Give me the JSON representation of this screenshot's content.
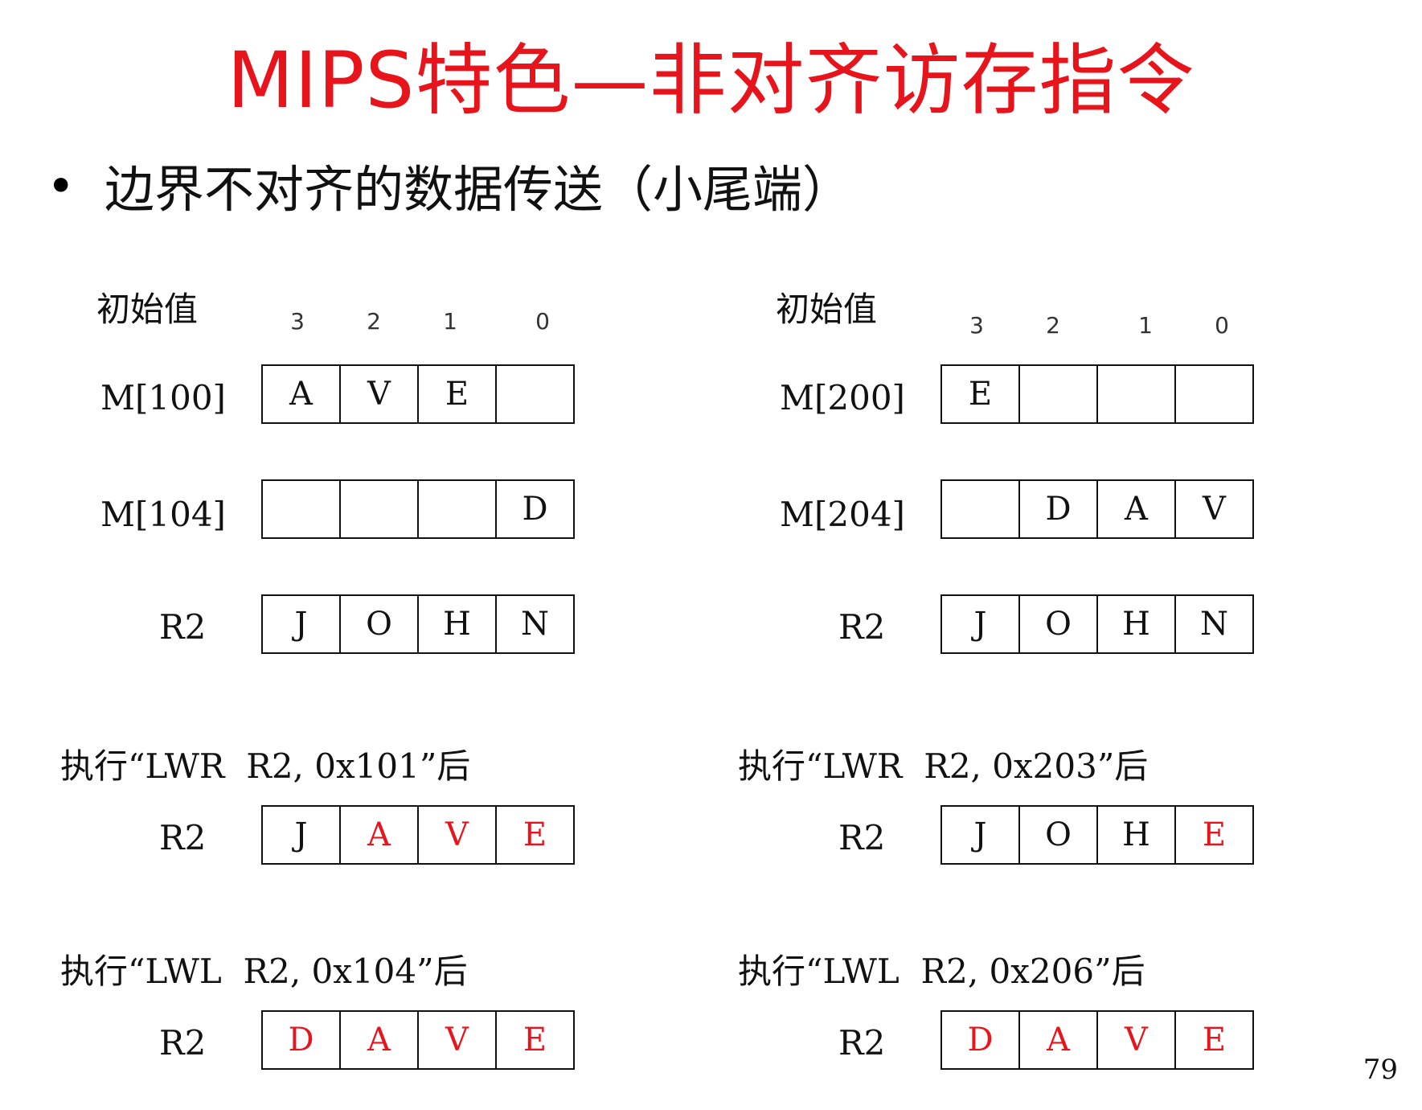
{
  "title": "MIPS特色—非对齐访存指令",
  "bullet": "边界不对齐的数据传送（小尾端）",
  "byte_indices": [
    "3",
    "2",
    "1",
    "0"
  ],
  "left": {
    "initial_label": "初始值",
    "rows": [
      {
        "label": "M[100]",
        "cells": [
          "A",
          "V",
          "E",
          ""
        ],
        "hl": [
          false,
          false,
          false,
          false
        ]
      },
      {
        "label": "M[104]",
        "cells": [
          "",
          "",
          "",
          "D"
        ],
        "hl": [
          false,
          false,
          false,
          false
        ]
      },
      {
        "label": "R2",
        "cells": [
          "J",
          "O",
          "H",
          "N"
        ],
        "hl": [
          false,
          false,
          false,
          false
        ]
      }
    ],
    "ops": [
      {
        "text": "执行“LWR  R2, 0x101”后",
        "reg_label": "R2",
        "cells": [
          "J",
          "A",
          "V",
          "E"
        ],
        "hl": [
          false,
          true,
          true,
          true
        ]
      },
      {
        "text": "执行“LWL  R2, 0x104”后",
        "reg_label": "R2",
        "cells": [
          "D",
          "A",
          "V",
          "E"
        ],
        "hl": [
          true,
          true,
          true,
          true
        ]
      }
    ]
  },
  "right": {
    "initial_label": "初始值",
    "rows": [
      {
        "label": "M[200]",
        "cells": [
          "E",
          "",
          "",
          ""
        ],
        "hl": [
          false,
          false,
          false,
          false
        ]
      },
      {
        "label": "M[204]",
        "cells": [
          "",
          "D",
          "A",
          "V"
        ],
        "hl": [
          false,
          false,
          false,
          false
        ]
      },
      {
        "label": "R2",
        "cells": [
          "J",
          "O",
          "H",
          "N"
        ],
        "hl": [
          false,
          false,
          false,
          false
        ]
      }
    ],
    "ops": [
      {
        "text": "执行“LWR  R2, 0x203”后",
        "reg_label": "R2",
        "cells": [
          "J",
          "O",
          "H",
          "E"
        ],
        "hl": [
          false,
          false,
          false,
          true
        ]
      },
      {
        "text": "执行“LWL  R2, 0x206”后",
        "reg_label": "R2",
        "cells": [
          "D",
          "A",
          "V",
          "E"
        ],
        "hl": [
          true,
          true,
          true,
          true
        ]
      }
    ]
  },
  "page_number": "79",
  "colors": {
    "accent": "#e8141c",
    "text": "#111111"
  }
}
